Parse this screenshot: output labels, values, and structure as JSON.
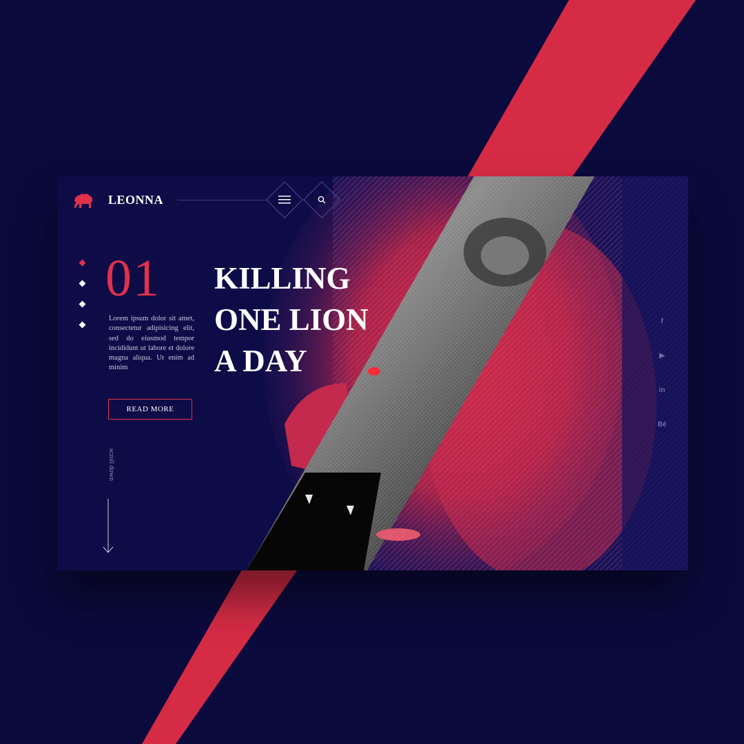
{
  "header": {
    "brand": "LEONNA",
    "menu_icon": "hamburger-icon",
    "search_icon": "search-icon"
  },
  "hero": {
    "slide_number": "01",
    "slides_total_dots": 4,
    "active_slide": 1,
    "body": "Lorem ipsum dolor sit amet, consectetur adipisicing elit, sed do eiusmod tempor incididunt ut labore et dolore magna aliqua. Ut enim ad minim",
    "cta_label": "READ MORE",
    "headline_lines": [
      "KILLING",
      "ONE LION",
      "A DAY"
    ],
    "scroll_label": "scroll down"
  },
  "social": [
    {
      "name": "facebook-icon",
      "glyph": "f"
    },
    {
      "name": "youtube-icon",
      "glyph": "▶"
    },
    {
      "name": "linkedin-icon",
      "glyph": "in"
    },
    {
      "name": "behance-icon",
      "glyph": "Bē"
    }
  ],
  "colors": {
    "background": "#0b0a3d",
    "card": "#0e0c47",
    "accent": "#e0314b",
    "text": "#ffffff"
  }
}
